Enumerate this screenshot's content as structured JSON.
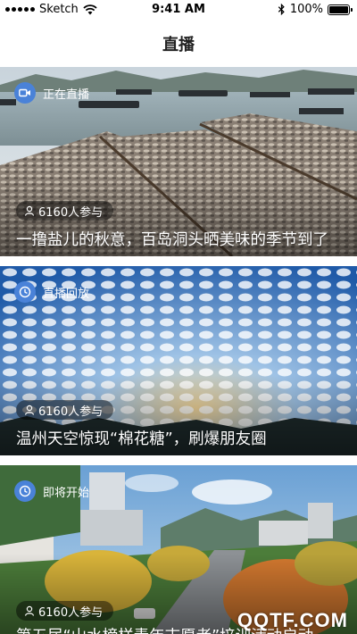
{
  "status_bar": {
    "carrier": "Sketch",
    "time": "9:41 AM",
    "battery": "100%",
    "signal_icon": "signal-dots-icon",
    "wifi_icon": "wifi-icon",
    "bluetooth_icon": "bluetooth-icon",
    "battery_icon": "battery-icon"
  },
  "header": {
    "title": "直播"
  },
  "cards": [
    {
      "status_icon": "video-camera-icon",
      "status": "正在直播",
      "participant_icon": "person-icon",
      "participants": "6160人参与",
      "title": "一撸盐儿的秋意，百岛洞头晒美味的季节到了"
    },
    {
      "status_icon": "clock-icon",
      "status": "直播回放",
      "participant_icon": "person-icon",
      "participants": "6160人参与",
      "title": "温州天空惊现“棉花糖”，刷爆朋友圈"
    },
    {
      "status_icon": "clock-icon",
      "status": "即将开始",
      "participant_icon": "person-icon",
      "participants": "6160人参与",
      "title": "第五届“山水榜样青年志愿者”培训活动启动"
    }
  ],
  "watermark": "QQTF.COM",
  "colors": {
    "accent_blue": "#4a82d8",
    "header_text": "#222222",
    "background": "#ffffff"
  }
}
